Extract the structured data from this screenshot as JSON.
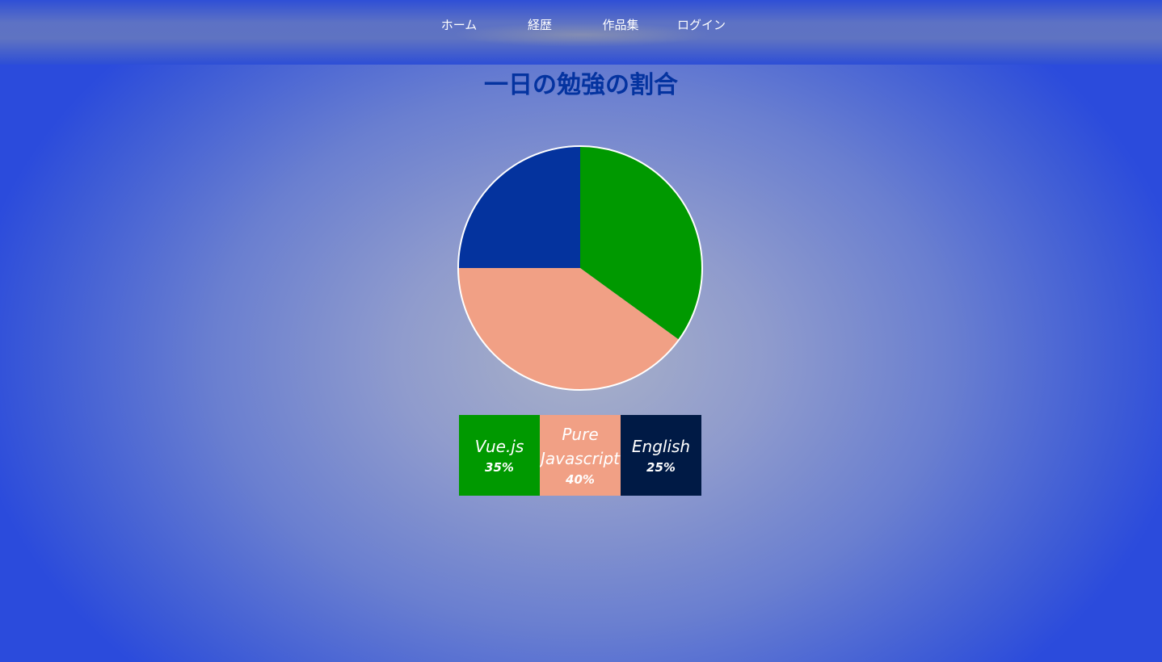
{
  "nav": {
    "items": [
      {
        "label": "ホーム"
      },
      {
        "label": "経歴"
      },
      {
        "label": "作品集"
      },
      {
        "label": "ログイン"
      }
    ]
  },
  "page": {
    "title": "一日の勉強の割合"
  },
  "chart_data": {
    "type": "pie",
    "title": "一日の勉強の割合",
    "series": [
      {
        "name": "Vue.js",
        "value": 35,
        "label": "35%",
        "color": "#009900"
      },
      {
        "name": "Pure Javascript",
        "value": 40,
        "label": "40%",
        "color": "#f1a085"
      },
      {
        "name": "English",
        "value": 25,
        "label": "25%",
        "color": "#04339e"
      }
    ],
    "legend_colors": [
      "#009900",
      "#f1a085",
      "#001a45"
    ],
    "start_angle": "12 o'clock",
    "direction": "clockwise"
  }
}
